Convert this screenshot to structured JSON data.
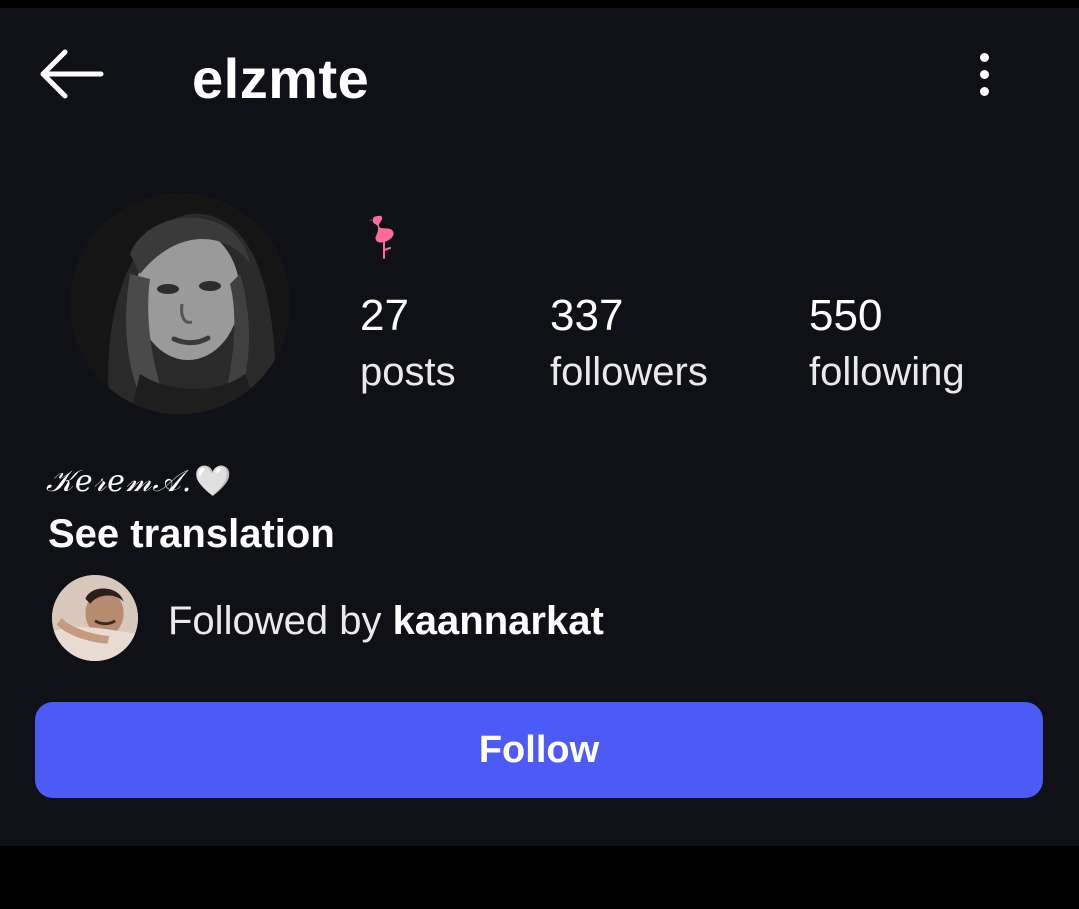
{
  "header": {
    "username": "elzmte",
    "back_icon": "arrow-left-icon",
    "menu_icon": "more-vertical-icon"
  },
  "profile": {
    "emoji_icon": "flamingo-icon",
    "stats": {
      "posts": {
        "value": "27",
        "label": "posts"
      },
      "followers": {
        "value": "337",
        "label": "followers"
      },
      "following": {
        "value": "550",
        "label": "following"
      }
    },
    "bio": "𝒦𝑒𝓇𝑒𝓂𝒜.",
    "bio_heart": "🤍",
    "see_translation": "See translation",
    "followed_by_prefix": "Followed by ",
    "followed_by_user": "kaannarkat"
  },
  "actions": {
    "follow_label": "Follow"
  },
  "colors": {
    "background": "#0f1117",
    "accent": "#4c5bf5",
    "text": "#ffffff"
  }
}
